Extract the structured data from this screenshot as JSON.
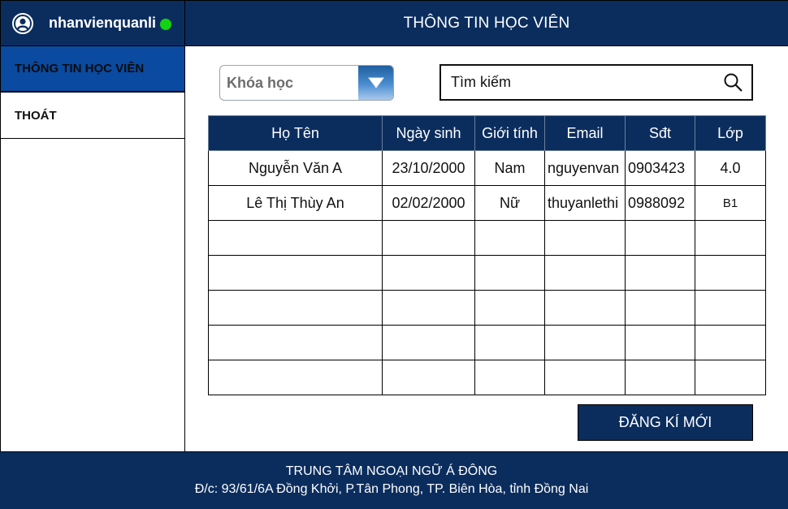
{
  "user": {
    "name": "nhanvienquanli",
    "status_color": "#14d314"
  },
  "header": {
    "title": "THÔNG TIN HỌC VIÊN"
  },
  "sidebar": {
    "items": [
      {
        "label": "THÔNG TIN HỌC VIÊN",
        "active": true
      },
      {
        "label": "THOÁT",
        "active": false
      }
    ]
  },
  "filter": {
    "course_label": "Khóa học"
  },
  "search": {
    "placeholder": "Tìm kiếm",
    "icon": "search-icon"
  },
  "table": {
    "columns": [
      "Họ Tên",
      "Ngày sinh",
      "Giới tính",
      "Email",
      "Sđt",
      "Lớp"
    ],
    "rows": [
      [
        "Nguyễn Văn A",
        "23/10/2000",
        "Nam",
        "nguyenvan",
        "0903423",
        "4.0"
      ],
      [
        "Lê Thị Thùy An",
        "02/02/2000",
        "Nữ",
        "thuyanlethi",
        "0988092",
        "B1"
      ],
      [
        "",
        "",
        "",
        "",
        "",
        ""
      ],
      [
        "",
        "",
        "",
        "",
        "",
        ""
      ],
      [
        "",
        "",
        "",
        "",
        "",
        ""
      ],
      [
        "",
        "",
        "",
        "",
        "",
        ""
      ],
      [
        "",
        "",
        "",
        "",
        "",
        ""
      ]
    ]
  },
  "actions": {
    "register_label": "ĐĂNG KÍ MỚI"
  },
  "footer": {
    "line1": "TRUNG TÂM NGOẠI NGỮ Á ĐÔNG",
    "line2": "Đ/c: 93/61/6A Đồng Khởi, P.Tân Phong, TP. Biên Hòa, tỉnh Đồng Nai"
  },
  "colors": {
    "primary": "#0b2d5e",
    "active_nav": "#0a4aa0"
  }
}
